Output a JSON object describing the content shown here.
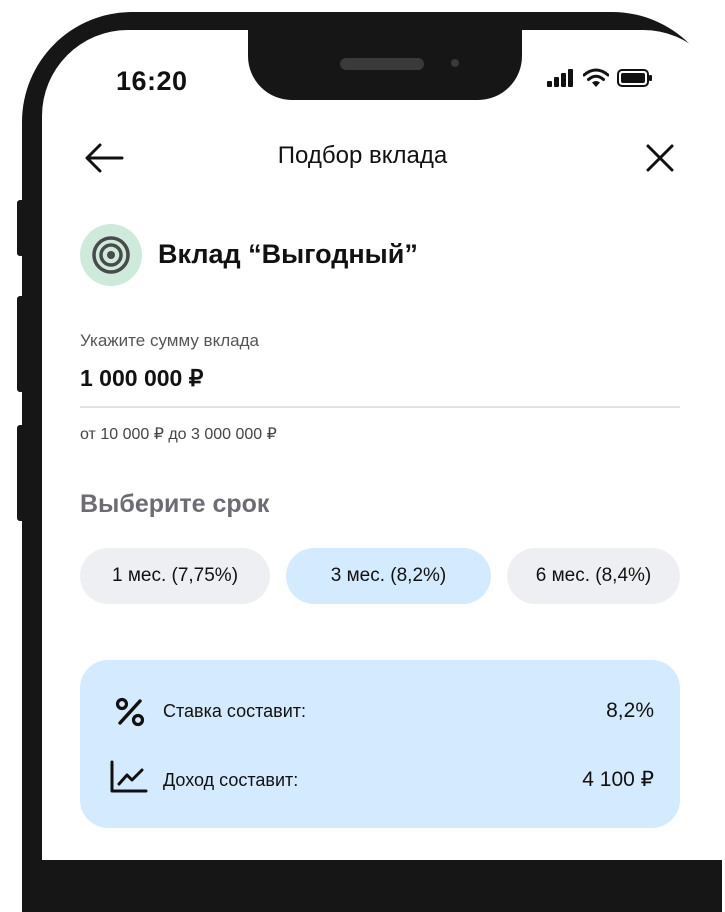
{
  "status_bar": {
    "time": "16:20"
  },
  "header": {
    "title": "Подбор вклада"
  },
  "product": {
    "title": "Вклад “Выгодный”"
  },
  "amount": {
    "label": "Укажите сумму вклада",
    "value": "1 000 000 ₽",
    "hint": "от 10 000 ₽ до 3 000 000 ₽"
  },
  "term": {
    "title": "Выберите срок",
    "options": [
      {
        "label": "1 мес. (7,75%)",
        "selected": false
      },
      {
        "label": "3 мес. (8,2%)",
        "selected": true
      },
      {
        "label": "6 мес. (8,4%)",
        "selected": false
      }
    ]
  },
  "summary": {
    "rate_label": "Ставка составит:",
    "rate_value": "8,2%",
    "income_label": "Доход составит:",
    "income_value": "4 100 ₽"
  },
  "colors": {
    "accent_light": "#d4eaff",
    "chip_bg": "#eeeff2",
    "product_icon_bg": "#cdeadb",
    "product_icon_fg": "#4a4a4a"
  }
}
